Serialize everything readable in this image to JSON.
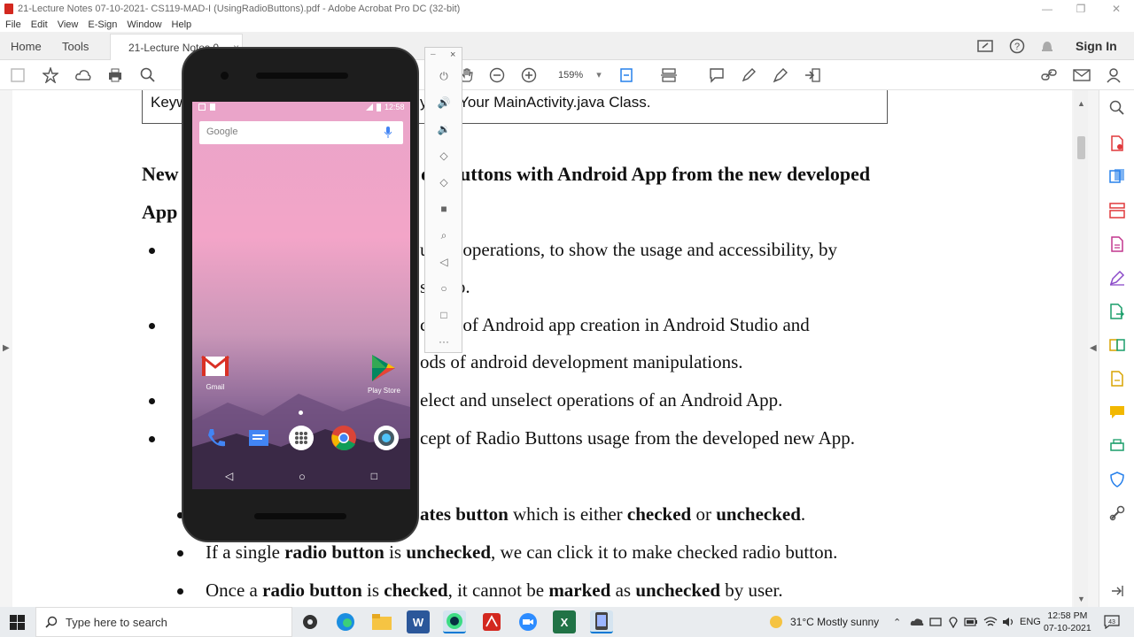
{
  "window": {
    "title": "21-Lecture Notes 07-10-2021- CS119-MAD-I (UsingRadioButtons).pdf - Adobe Acrobat Pro DC (32-bit)",
    "controls": [
      "minimize",
      "restore",
      "close"
    ]
  },
  "menu": [
    "File",
    "Edit",
    "View",
    "E-Sign",
    "Window",
    "Help"
  ],
  "tabs": {
    "home": "Home",
    "tools": "Tools",
    "document": "21-Lecture Notes 0...",
    "close": "×",
    "signin": "Sign In"
  },
  "toolbar": {
    "zoom": "159%",
    "zoom_arrow": "▾"
  },
  "document": {
    "keywords_visible_left": "Keyw",
    "keywords_visible_right": "yzing Your MainActivity.java Class.",
    "heading_line1_left": "New",
    "heading_line1_right": "dioButtons with Android App from the new developed",
    "heading_line2_left": "App",
    "bullets": [
      {
        "line1": "utton operations, to show the usage and accessibility, by",
        "line2": "studio."
      },
      {
        "line1": "cepts of Android app creation in Android Studio and",
        "line2": "ods of android development manipulations."
      },
      {
        "line1": "elect and unselect operations of an Android App.",
        "line2": ""
      },
      {
        "line1": "cept of Radio Buttons usage from the developed new App.",
        "line2": ""
      }
    ],
    "sub_bullets": [
      {
        "parts": [
          {
            "t": "ates button",
            "b": true
          },
          {
            "t": " which is either ",
            "b": false
          },
          {
            "t": "checked",
            "b": true
          },
          {
            "t": " or ",
            "b": false
          },
          {
            "t": "unchecked",
            "b": true
          },
          {
            "t": ".",
            "b": false
          }
        ]
      },
      {
        "parts": [
          {
            "t": "If a single ",
            "b": false
          },
          {
            "t": "radio button",
            "b": true
          },
          {
            "t": " is ",
            "b": false
          },
          {
            "t": "unchecked",
            "b": true
          },
          {
            "t": ", we can click it to make checked radio button.",
            "b": false
          }
        ]
      },
      {
        "parts": [
          {
            "t": "Once a ",
            "b": false
          },
          {
            "t": "radio button",
            "b": true
          },
          {
            "t": " is ",
            "b": false
          },
          {
            "t": "checked",
            "b": true
          },
          {
            "t": ", it cannot be ",
            "b": false
          },
          {
            "t": "marked",
            "b": true
          },
          {
            "t": " as ",
            "b": false
          },
          {
            "t": "unchecked",
            "b": true
          },
          {
            "t": " by user.",
            "b": false
          }
        ]
      }
    ]
  },
  "emulator": {
    "time": "12:58",
    "search_logo": "Google",
    "apps": {
      "gmail": "Gmail",
      "play_store": "Play Store"
    },
    "dock": [
      "phone",
      "messages",
      "app-drawer",
      "chrome",
      "camera"
    ],
    "side_panel": [
      "power",
      "volume-up",
      "volume-down",
      "rotate-left",
      "rotate-right",
      "screenshot",
      "zoom",
      "back",
      "home",
      "overview",
      "more"
    ],
    "panel_controls": {
      "minimize": "–",
      "close": "×"
    }
  },
  "taskbar": {
    "search_placeholder": "Type here to search",
    "weather": "31°C  Mostly sunny",
    "lang": "ENG",
    "time": "12:58 PM",
    "date": "07-10-2021",
    "notifications": "43"
  },
  "colors": {
    "acrobat_red": "#d3281f",
    "blue_icon": "#2680eb"
  }
}
